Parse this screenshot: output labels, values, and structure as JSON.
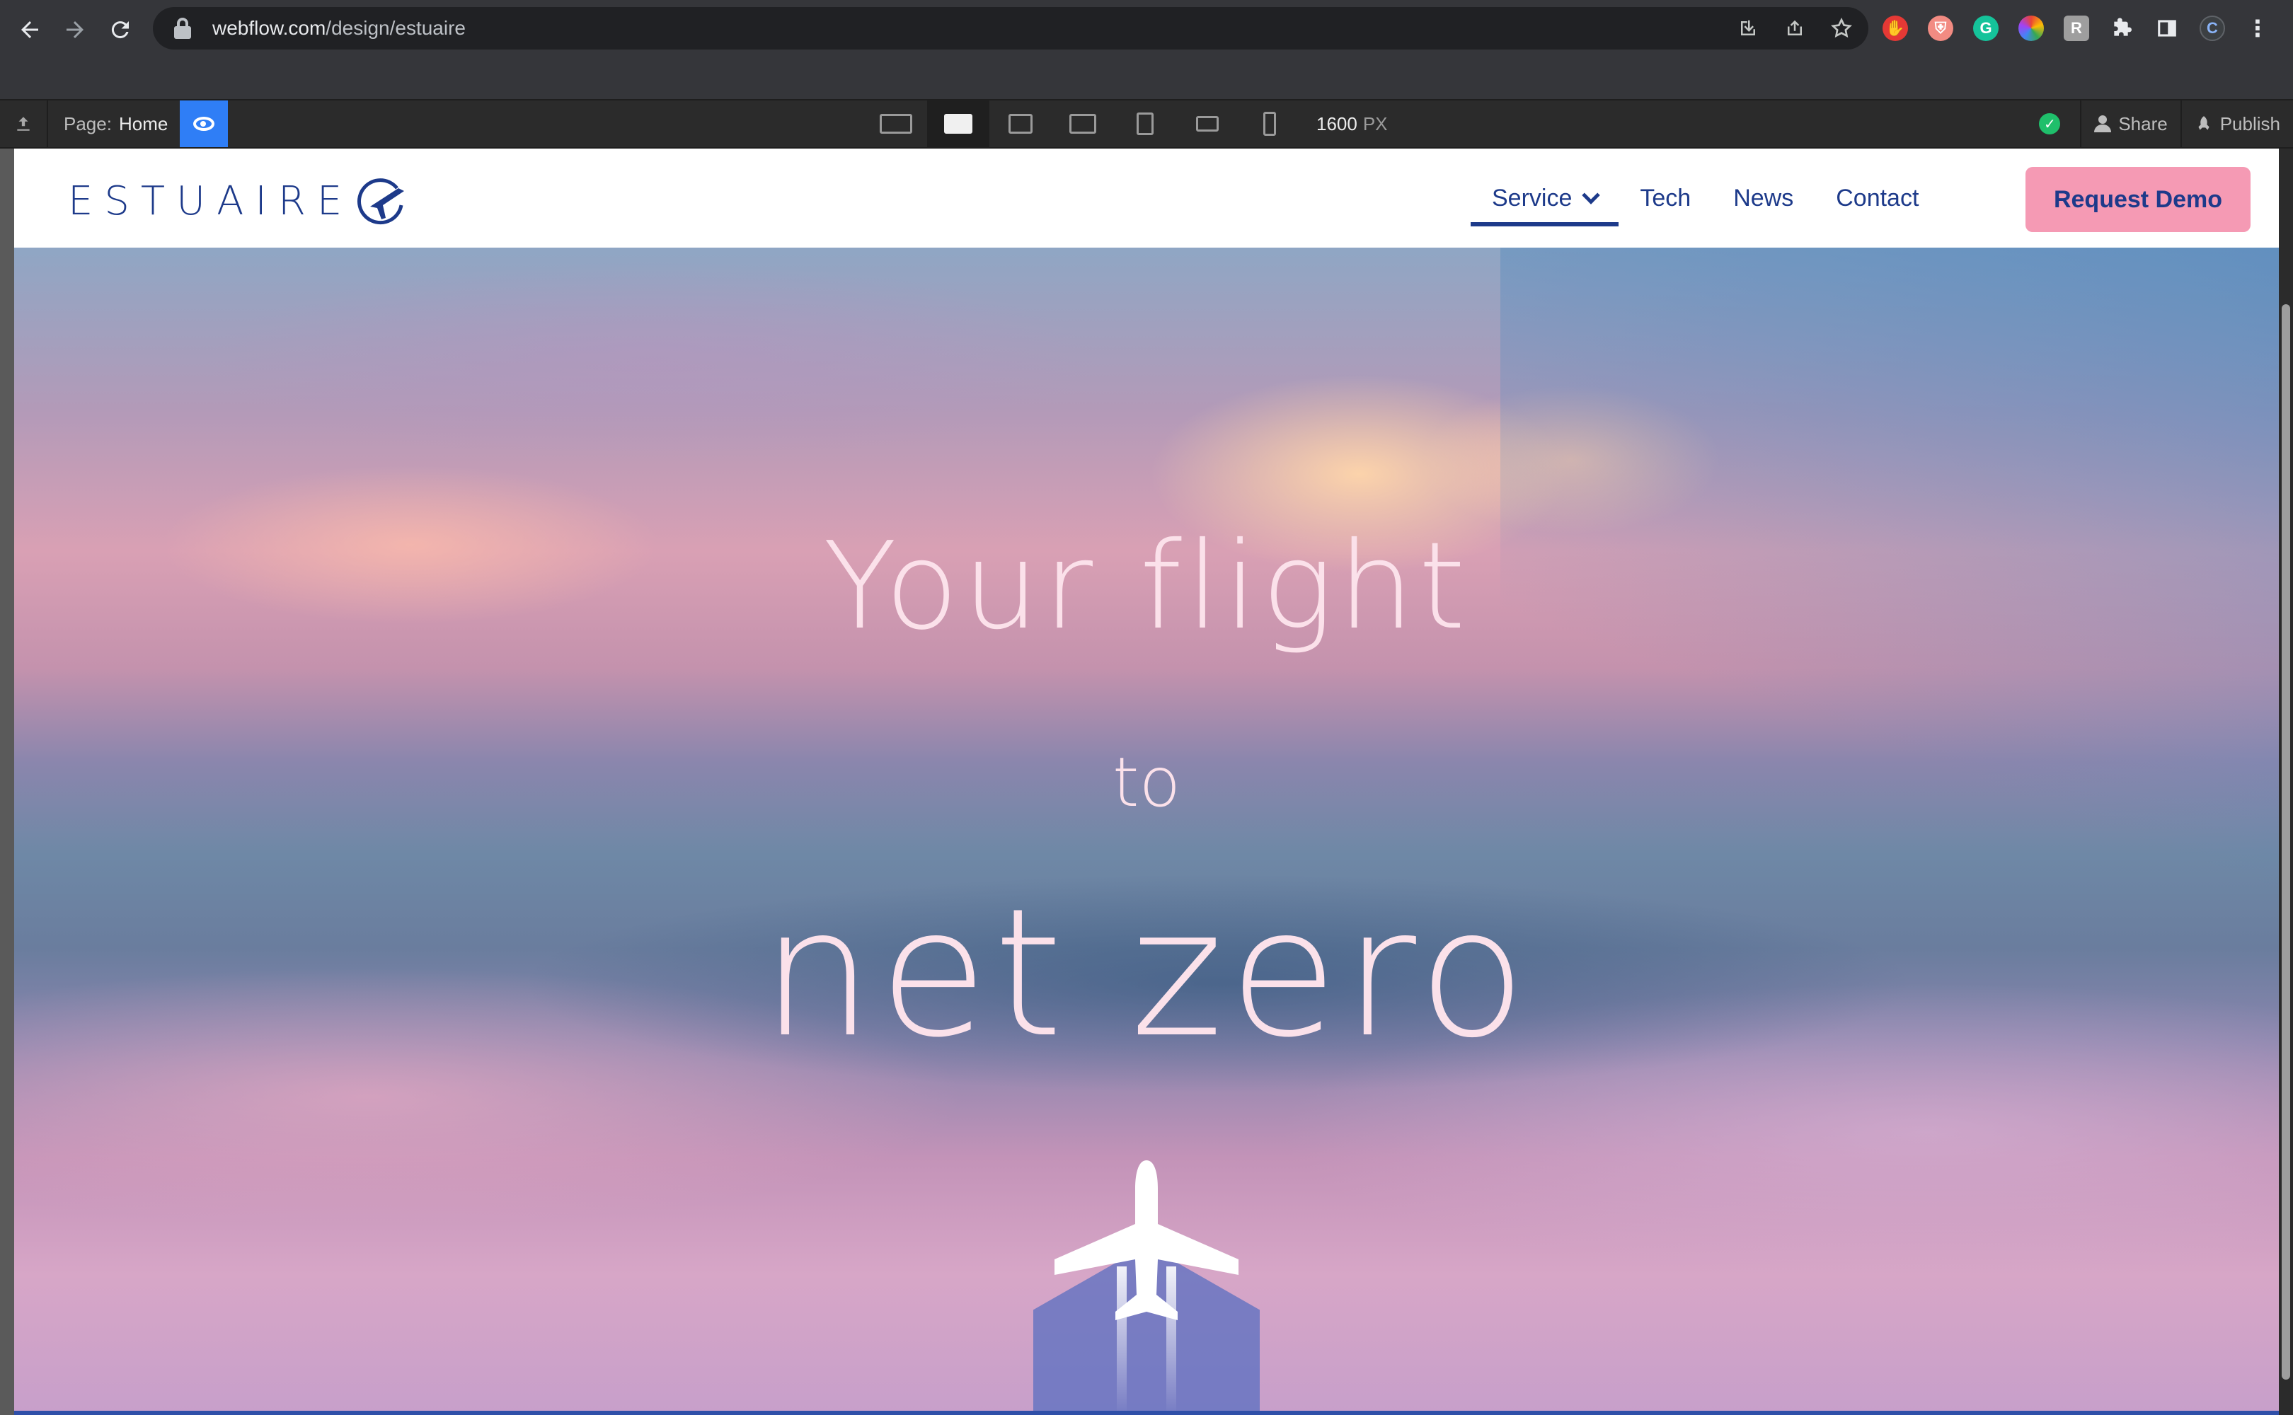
{
  "browser": {
    "url_host": "webflow.com",
    "url_path": "/design/estuaire",
    "nav_icons": [
      "back-icon",
      "forward-icon",
      "reload-icon"
    ],
    "omnibox_icons": [
      "install-icon",
      "share-icon",
      "star-icon"
    ],
    "extensions": [
      {
        "name": "adblock-extension-icon",
        "color": "#e53935",
        "glyph": "✋"
      },
      {
        "name": "shield-extension-icon",
        "color": "#f28b82",
        "glyph": "⛨"
      },
      {
        "name": "grammarly-extension-icon",
        "color": "#15c39a",
        "glyph": "G"
      },
      {
        "name": "color-picker-extension-icon",
        "color": "#4285f4",
        "glyph": "✿"
      },
      {
        "name": "readwise-extension-icon",
        "color": "#9e9e9e",
        "glyph": "R"
      },
      {
        "name": "extensions-puzzle-icon",
        "color": "",
        "glyph": "✚"
      },
      {
        "name": "side-panel-icon",
        "color": "",
        "glyph": "▮"
      },
      {
        "name": "profile-avatar",
        "color": "#3c4043",
        "glyph": "C"
      },
      {
        "name": "chrome-menu-icon",
        "color": "",
        "glyph": "⋮"
      }
    ]
  },
  "designer": {
    "page_label": "Page:",
    "page_name": "Home",
    "canvas_width_value": "1600",
    "canvas_width_unit": "PX",
    "share_label": "Share",
    "publish_label": "Publish",
    "active_breakpoint": "desktop-base"
  },
  "site": {
    "brand": "ESTUAIRE",
    "nav": {
      "service": "Service",
      "tech": "Tech",
      "news": "News",
      "contact": "Contact"
    },
    "cta": "Request Demo",
    "hero": {
      "line1": "Your flight",
      "line2": "to",
      "line3": "net zero"
    }
  },
  "colors": {
    "brand_blue": "#1d3a8a",
    "cta_pink": "#f59ab4",
    "hero_text": "#fbe1ea",
    "webflow_blue": "#2f7ef6"
  }
}
